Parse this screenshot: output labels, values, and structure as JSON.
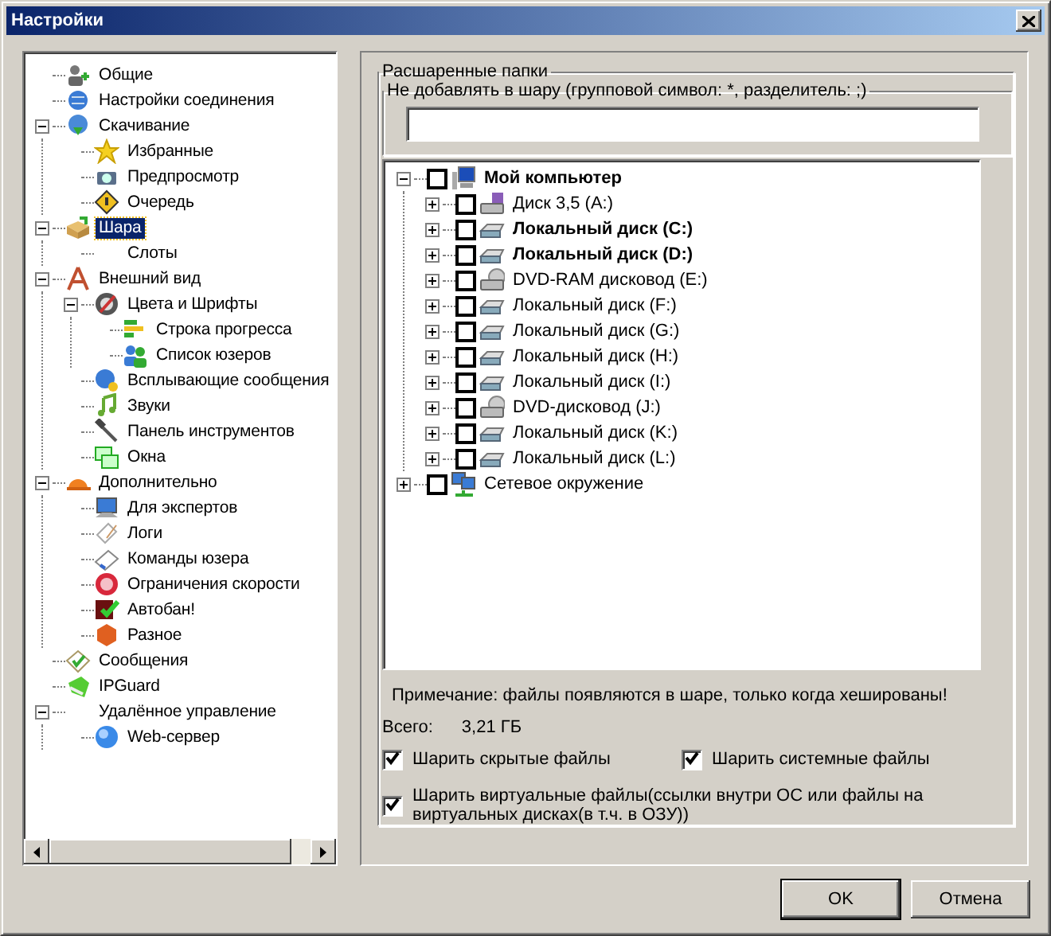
{
  "window": {
    "title": "Настройки"
  },
  "nav_tree": [
    {
      "label": "Общие",
      "selected": false
    },
    {
      "label": "Настройки соединения",
      "selected": false
    },
    {
      "label": "Скачивание",
      "selected": false,
      "expanded": true,
      "children": [
        {
          "label": "Избранные",
          "selected": false
        },
        {
          "label": "Предпросмотр",
          "selected": false
        },
        {
          "label": "Очередь",
          "selected": false
        }
      ]
    },
    {
      "label": "Шара",
      "selected": true,
      "expanded": true,
      "children": [
        {
          "label": "Слоты",
          "selected": false
        }
      ]
    },
    {
      "label": "Внешний вид",
      "selected": false,
      "expanded": true,
      "children": [
        {
          "label": "Цвета и Шрифты",
          "selected": false,
          "expanded": true,
          "children": [
            {
              "label": "Строка прогресса",
              "selected": false
            },
            {
              "label": "Список юзеров",
              "selected": false
            }
          ]
        },
        {
          "label": "Всплывающие сообщения",
          "selected": false
        },
        {
          "label": "Звуки",
          "selected": false
        },
        {
          "label": "Панель инструментов",
          "selected": false
        },
        {
          "label": "Окна",
          "selected": false
        }
      ]
    },
    {
      "label": "Дополнительно",
      "selected": false,
      "expanded": true,
      "children": [
        {
          "label": "Для экспертов",
          "selected": false
        },
        {
          "label": "Логи",
          "selected": false
        },
        {
          "label": "Команды юзера",
          "selected": false
        },
        {
          "label": "Ограничения скорости",
          "selected": false
        },
        {
          "label": "Автобан!",
          "selected": false
        },
        {
          "label": "Разное",
          "selected": false
        }
      ]
    },
    {
      "label": "Сообщения",
      "selected": false
    },
    {
      "label": "IPGuard",
      "selected": false
    },
    {
      "label": "Удалённое управление",
      "selected": false,
      "expanded": true,
      "children": [
        {
          "label": "Web-сервер",
          "selected": false
        }
      ]
    }
  ],
  "shared_folders": {
    "title": "Расшаренные папки",
    "exclude": {
      "title": "Не добавлять в шару (групповой символ: *, разделитель: ;)"
    },
    "tree": [
      {
        "label": "Мой компьютер",
        "bold": true,
        "checked": false,
        "expanded": true,
        "children": [
          {
            "label": "Диск 3,5 (A:)",
            "bold": false,
            "checked": false,
            "expanded": false
          },
          {
            "label": "Локальный диск (C:)",
            "bold": true,
            "checked": false,
            "expanded": false
          },
          {
            "label": "Локальный диск (D:)",
            "bold": true,
            "checked": false,
            "expanded": false
          },
          {
            "label": "DVD-RAM дисковод (E:)",
            "bold": false,
            "checked": false,
            "expanded": false
          },
          {
            "label": "Локальный диск (F:)",
            "bold": false,
            "checked": false,
            "expanded": false
          },
          {
            "label": "Локальный диск (G:)",
            "bold": false,
            "checked": false,
            "expanded": false
          },
          {
            "label": "Локальный диск (H:)",
            "bold": false,
            "checked": false,
            "expanded": false
          },
          {
            "label": "Локальный диск (I:)",
            "bold": false,
            "checked": false,
            "expanded": false
          },
          {
            "label": "DVD-дисковод (J:)",
            "bold": false,
            "checked": false,
            "expanded": false
          },
          {
            "label": "Локальный диск (K:)",
            "bold": false,
            "checked": false,
            "expanded": false
          },
          {
            "label": "Локальный диск (L:)",
            "bold": false,
            "checked": false,
            "expanded": false
          }
        ]
      },
      {
        "label": "Сетевое окружение",
        "bold": false,
        "checked": false,
        "expanded": false
      }
    ],
    "note": "Примечание: файлы появляются в шаре, только когда хешированы!",
    "total_label": "Всего:",
    "total_value": "3,21 ГБ",
    "options": [
      {
        "label": "Шарить скрытые файлы",
        "checked": true
      },
      {
        "label": "Шарить системные файлы",
        "checked": true
      },
      {
        "label": "Шарить виртуальные файлы(ссылки внутри ОС или файлы на виртуальных дисках(в т.ч. в ОЗУ))",
        "checked": true
      }
    ]
  },
  "buttons": [
    {
      "label": "OK",
      "default": true
    },
    {
      "label": "Отмена",
      "default": false
    }
  ]
}
